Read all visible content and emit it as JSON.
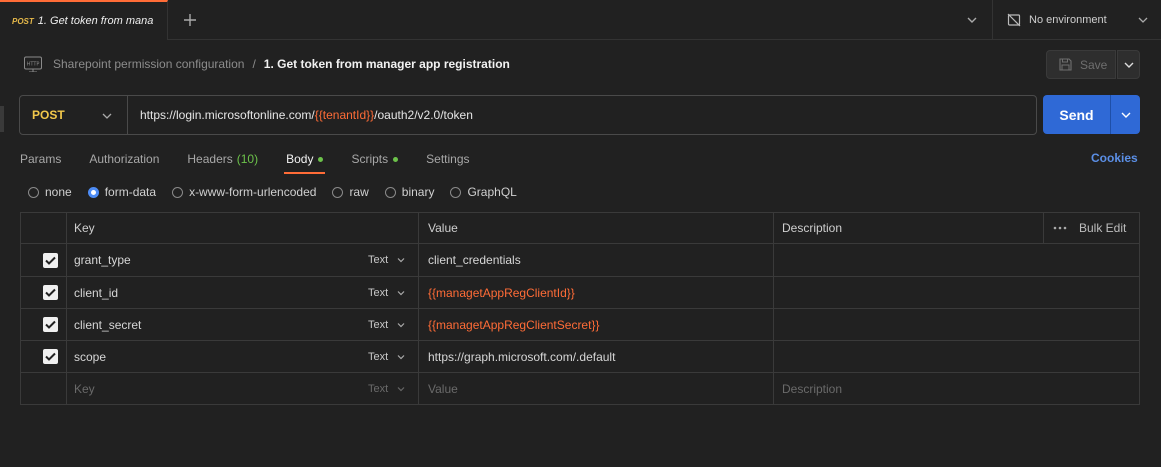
{
  "tab": {
    "method": "POST",
    "name": "1. Get token from mana"
  },
  "environment": {
    "label": "No environment"
  },
  "breadcrumb": {
    "parent": "Sharepoint permission configuration",
    "separator": "/",
    "current": "1. Get token from manager app registration"
  },
  "save": {
    "label": "Save"
  },
  "request": {
    "method": "POST",
    "url_prefix": "https://login.microsoftonline.com/",
    "url_variable": "{{tenantId}}",
    "url_suffix": "/oauth2/v2.0/token"
  },
  "send": {
    "label": "Send"
  },
  "request_tabs": [
    {
      "label": "Params"
    },
    {
      "label": "Authorization"
    },
    {
      "label": "Headers",
      "count": "(10)"
    },
    {
      "label": "Body",
      "active": true,
      "dot": true
    },
    {
      "label": "Scripts",
      "dot": true
    },
    {
      "label": "Settings"
    }
  ],
  "cookies": {
    "label": "Cookies"
  },
  "body_types": [
    {
      "label": "none",
      "selected": false
    },
    {
      "label": "form-data",
      "selected": true
    },
    {
      "label": "x-www-form-urlencoded",
      "selected": false
    },
    {
      "label": "raw",
      "selected": false
    },
    {
      "label": "binary",
      "selected": false
    },
    {
      "label": "GraphQL",
      "selected": false
    }
  ],
  "table": {
    "headers": {
      "key": "Key",
      "value": "Value",
      "description": "Description",
      "bulk_edit": "Bulk Edit"
    },
    "rows": [
      {
        "key": "grant_type",
        "type": "Text",
        "value": "client_credentials",
        "is_var": false
      },
      {
        "key": "client_id",
        "type": "Text",
        "value": "{{managetAppRegClientId}}",
        "is_var": true
      },
      {
        "key": "client_secret",
        "type": "Text",
        "value": "{{managetAppRegClientSecret}}",
        "is_var": true
      },
      {
        "key": "scope",
        "type": "Text",
        "value": "https://graph.microsoft.com/.default",
        "is_var": false
      }
    ],
    "placeholder": {
      "key": "Key",
      "type": "Text",
      "value": "Value",
      "description": "Description"
    }
  },
  "colors": {
    "accent": "#ff6c37",
    "send_button": "#2f69d6",
    "method": "#f2c84b",
    "link": "#5b8fe6",
    "indicator": "#6cc24a"
  }
}
